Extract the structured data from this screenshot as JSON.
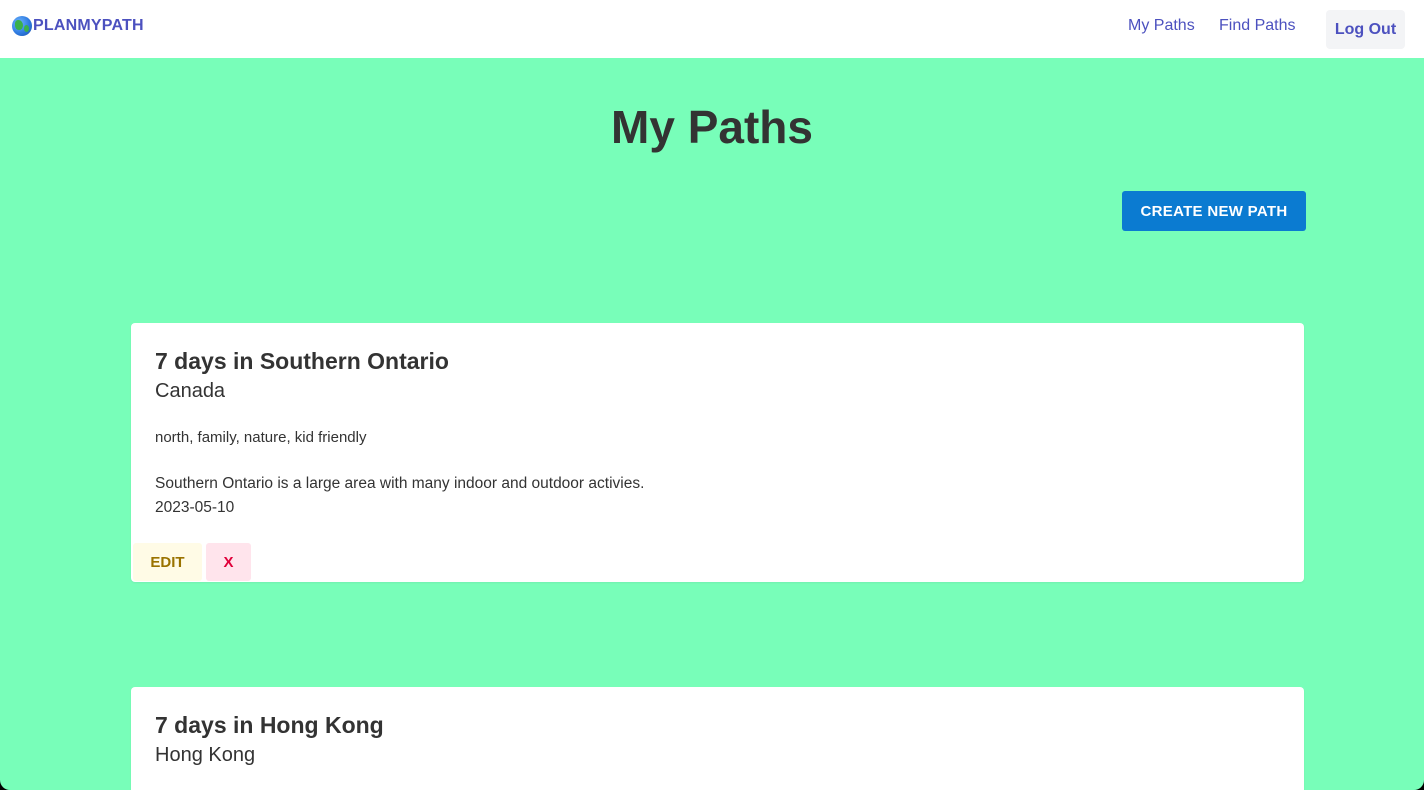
{
  "navbar": {
    "brand": "PLANMYPATH",
    "brand_icon": "globe-icon",
    "links": [
      "My Paths",
      "Find Paths"
    ],
    "logout_label": "Log Out"
  },
  "main": {
    "title": "My Paths",
    "create_label": "CREATE NEW PATH",
    "paths": [
      {
        "title": "7 days in Southern Ontario",
        "country": "Canada",
        "tags": "north, family, nature, kid friendly",
        "description": "Southern Ontario is a large area with many indoor and outdoor activies.",
        "date": "2023-05-10",
        "edit_label": "EDIT",
        "delete_label": "X"
      },
      {
        "title": "7 days in Hong Kong",
        "country": "Hong Kong"
      }
    ]
  },
  "colors": {
    "background": "#78feb9",
    "brand": "#4c51bf",
    "primary_button": "#0b7bd1",
    "edit_button_bg": "#fffbe6",
    "edit_button_text": "#9a7300",
    "delete_button_bg": "#ffe4ec",
    "delete_button_text": "#e0003a"
  }
}
